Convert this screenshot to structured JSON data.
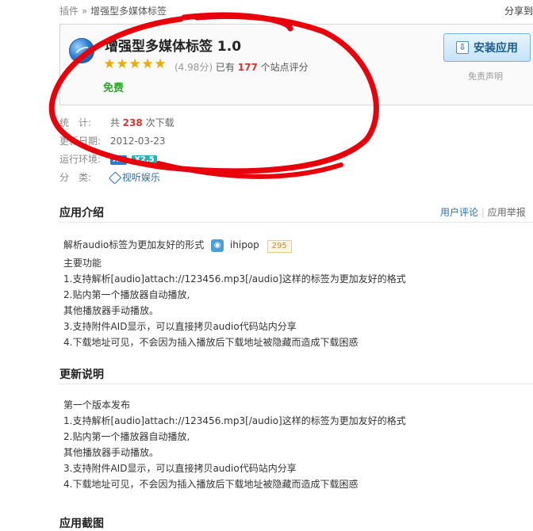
{
  "breadcrumb": {
    "root": "插件",
    "sep": "»",
    "current": "增强型多媒体标签"
  },
  "share_label": "分享到",
  "app": {
    "title": "增强型多媒体标签 1.0",
    "score": "(4.98分)",
    "rating_prefix": "已有",
    "rating_count": "177",
    "rating_suffix": "个站点评分",
    "stars": 5,
    "price": "免费",
    "install_label": "安装应用",
    "disclaimer": "免责声明"
  },
  "meta": {
    "stats_label": "统　计:",
    "stats_prefix": "共",
    "downloads": "238",
    "stats_suffix": "次下载",
    "updated_label": "更新日期:",
    "updated": "2012-03-23",
    "env_label": "运行环境:",
    "env_badges": [
      "X2",
      "X2.5"
    ],
    "category_label": "分　类:",
    "category": "视听娱乐"
  },
  "intro": {
    "title": "应用介绍",
    "links": {
      "reviews": "用户评论",
      "sep": "|",
      "report": "应用举报"
    },
    "headline": "解析audio标签为更加友好的形式",
    "author": "ihipop",
    "author_points": "295",
    "lines": [
      "主要功能",
      "1.支持解析[audio]attach://123456.mp3[/audio]这样的标签为更加友好的格式",
      "2.贴内第一个播放器自动播放,",
      "其他播放器手动播放。",
      "3.支持附件AID显示，可以直接拷贝audio代码站内分享",
      "4.下载地址可见，不会因为插入播放后下载地址被隐藏而造成下载困惑"
    ]
  },
  "changelog": {
    "title": "更新说明",
    "lines": [
      "第一个版本发布",
      "1.支持解析[audio]attach://123456.mp3[/audio]这样的标签为更加友好的格式",
      "2.贴内第一个播放器自动播放,",
      "其他播放器手动播放。",
      "3.支持附件AID显示，可以直接拷贝audio代码站内分享",
      "4.下载地址可见，不会因为插入播放后下载地址被隐藏而造成下载困惑"
    ]
  },
  "screenshots": {
    "title": "应用截图"
  },
  "colors": {
    "accent_link": "#2a6fb0",
    "highlight_red": "#d9362b",
    "free_green": "#2aa52a",
    "annotation": "#e8000b"
  }
}
